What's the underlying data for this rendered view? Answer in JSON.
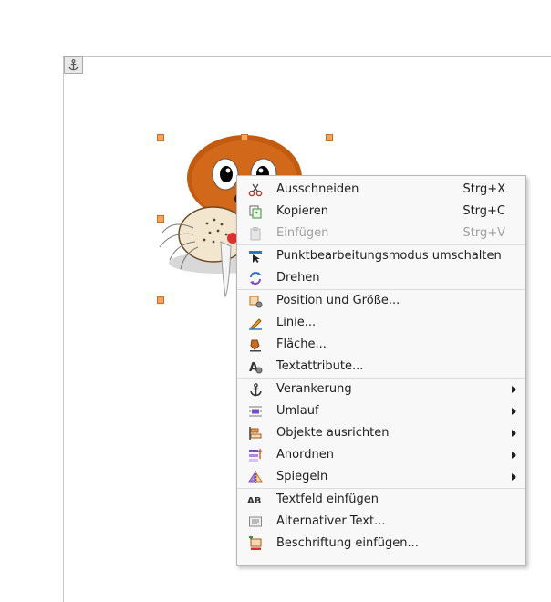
{
  "document": {
    "anchor_icon": "anchor-icon"
  },
  "context_menu": {
    "groups": [
      [
        {
          "label": "Ausschneiden",
          "shortcut": "Strg+X",
          "icon": "scissors-icon",
          "enabled": true,
          "submenu": false
        },
        {
          "label": "Kopieren",
          "shortcut": "Strg+C",
          "icon": "copy-icon",
          "enabled": true,
          "submenu": false
        },
        {
          "label": "Einfügen",
          "shortcut": "Strg+V",
          "icon": "paste-icon",
          "enabled": false,
          "submenu": false
        }
      ],
      [
        {
          "label": "Punktbearbeitungsmodus umschalten",
          "shortcut": "",
          "icon": "point-edit-icon",
          "enabled": true,
          "submenu": false
        },
        {
          "label": "Drehen",
          "shortcut": "",
          "icon": "rotate-icon",
          "enabled": true,
          "submenu": false
        }
      ],
      [
        {
          "label": "Position und Größe...",
          "shortcut": "",
          "icon": "position-size-icon",
          "enabled": true,
          "submenu": false
        },
        {
          "label": "Linie...",
          "shortcut": "",
          "icon": "line-pen-icon",
          "enabled": true,
          "submenu": false
        },
        {
          "label": "Fläche...",
          "shortcut": "",
          "icon": "area-fill-icon",
          "enabled": true,
          "submenu": false
        },
        {
          "label": "Textattribute...",
          "shortcut": "",
          "icon": "text-attributes-icon",
          "enabled": true,
          "submenu": false
        }
      ],
      [
        {
          "label": "Verankerung",
          "shortcut": "",
          "icon": "anchor-icon",
          "enabled": true,
          "submenu": true
        },
        {
          "label": "Umlauf",
          "shortcut": "",
          "icon": "wrap-icon",
          "enabled": true,
          "submenu": true
        },
        {
          "label": "Objekte ausrichten",
          "shortcut": "",
          "icon": "align-icon",
          "enabled": true,
          "submenu": true
        },
        {
          "label": "Anordnen",
          "shortcut": "",
          "icon": "arrange-icon",
          "enabled": true,
          "submenu": true
        },
        {
          "label": "Spiegeln",
          "shortcut": "",
          "icon": "flip-icon",
          "enabled": true,
          "submenu": true
        }
      ],
      [
        {
          "label": "Textfeld einfügen",
          "shortcut": "",
          "icon": "textbox-icon",
          "enabled": true,
          "submenu": false
        },
        {
          "label": "Alternativer Text...",
          "shortcut": "",
          "icon": "alt-text-icon",
          "enabled": true,
          "submenu": false
        },
        {
          "label": "Beschriftung einfügen...",
          "shortcut": "",
          "icon": "caption-icon",
          "enabled": true,
          "submenu": false
        }
      ]
    ]
  }
}
